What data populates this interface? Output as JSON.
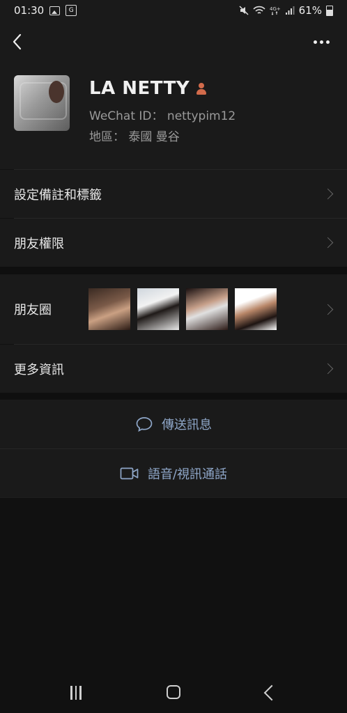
{
  "status": {
    "time": "01:30",
    "battery": "61%"
  },
  "profile": {
    "name": "LA NETTY",
    "wechat_id_label": "WeChat ID：",
    "wechat_id": "nettypim12",
    "region_label": "地區：",
    "region": "泰國  曼谷"
  },
  "menu": {
    "remarks_tags": "設定備註和標籤",
    "permissions": "朋友權限",
    "moments": "朋友圈",
    "more_info": "更多資訊"
  },
  "actions": {
    "send_message": "傳送訊息",
    "voice_video_call": "語音/視訊通話"
  },
  "colors": {
    "background": "#111111",
    "card": "#1a1a1a",
    "action_text": "#8fa7c9",
    "secondary_text": "#9a9a9a"
  }
}
